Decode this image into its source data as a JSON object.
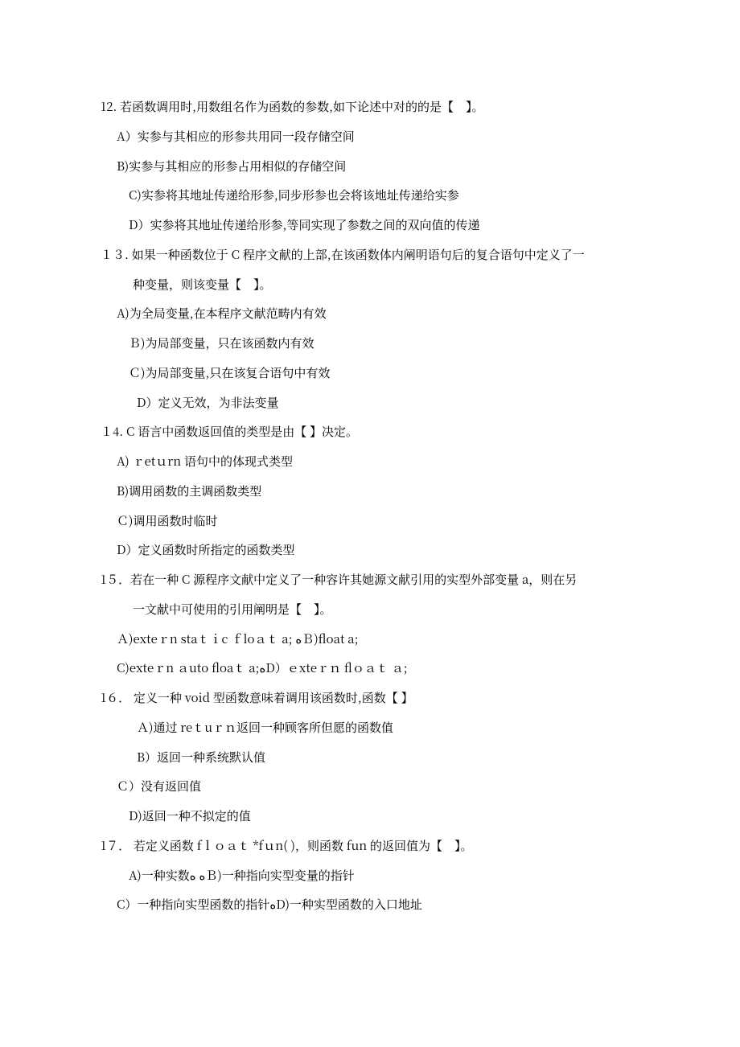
{
  "questions": [
    {
      "stem": "12.  若函数调用时,用数组名作为函数的参数,如下论述中对的的是【　】。",
      "stem_cont": "",
      "opts": [
        {
          "cls": "ind1",
          "t": "A）实参与其相应的形参共用同一段存储空间"
        },
        {
          "cls": "ind1",
          "t": "B)实参与其相应的形参占用相似的存储空间"
        },
        {
          "cls": "ind2",
          "t": "C)实参将其地址传递给形参,同步形参也会将该地址传递给实参"
        },
        {
          "cls": "ind2",
          "t": "D）实参将其地址传递给形参,等同实现了参数之间的双向值的传递"
        }
      ]
    },
    {
      "stem": "１３.  如果一种函数位于 C 程序文献的上部,在该函数体内阐明语句后的复合语句中定义了一",
      "stem_cont": "种变量，则该变量【　】。",
      "opts": [
        {
          "cls": "ind1",
          "t": "A)为全局变量,在本程序文献范畴内有效"
        },
        {
          "cls": "ind2",
          "t": "Ｂ)为局部变量，只在该函数内有效"
        },
        {
          "cls": "ind2",
          "t": "Ｃ)为局部变量,只在该复合语句中有效"
        },
        {
          "cls": "ind3",
          "t": "D）定义无效，为非法变量"
        }
      ]
    },
    {
      "stem": "１4. C 语言中函数返回值的类型是由【  】决定。",
      "stem_cont": "",
      "opts": [
        {
          "cls": "ind1",
          "t": "A) ｒetｕrn 语句中的体现式类型"
        },
        {
          "cls": "ind1",
          "t": "B)调用函数的主调函数类型"
        },
        {
          "cls": "ind1",
          "t": "Ｃ)调用函数时临时"
        },
        {
          "cls": "ind1",
          "t": "D）定义函数时所指定的函数类型"
        }
      ]
    },
    {
      "stem": "1５．若在一种 C 源程序文献中定义了一种容许其她源文献引用的实型外部变量 a，则在另",
      "stem_cont": "一文献中可使用的引用阐明是【　】。",
      "opts": [
        {
          "cls": "ind1",
          "t": "Ａ)exteｒn staｔｉc  ｆloａｔ  a; ﻩＢ)float a;"
        },
        {
          "cls": "ind1",
          "t": "C)exteｒn ａuto   floaｔ    a;ﻩD）ｅxteｒｎ    flｏａｔ  ａ;"
        }
      ]
    },
    {
      "stem": "1６． 定义一种 void 型函数意味着调用该函数时,函数【  】",
      "stem_cont": "",
      "opts": [
        {
          "cls": "ind3",
          "t": "Ａ)通过 reｔuｒｎ返回一种顾客所但愿的函数值"
        },
        {
          "cls": "ind3",
          "t": "B）返回一种系统默认值"
        },
        {
          "cls": "ind1",
          "t": "Ｃ）没有返回值"
        },
        {
          "cls": "ind2",
          "t": "D)返回一种不拟定的值"
        }
      ]
    },
    {
      "stem": "1７． 若定义函数 fｌｏａｔ  *fｕn(     )，则函数 fun 的返回值为【　】。",
      "stem_cont": "",
      "opts": [
        {
          "cls": "ind2",
          "t": "A)一种实数ﻩ            ﻩＢ)一种指向实型变量的指针"
        },
        {
          "cls": "ind1",
          "t": "C）一种指向实型函数的指针ﻩD)一种实型函数的入口地址"
        }
      ]
    }
  ]
}
